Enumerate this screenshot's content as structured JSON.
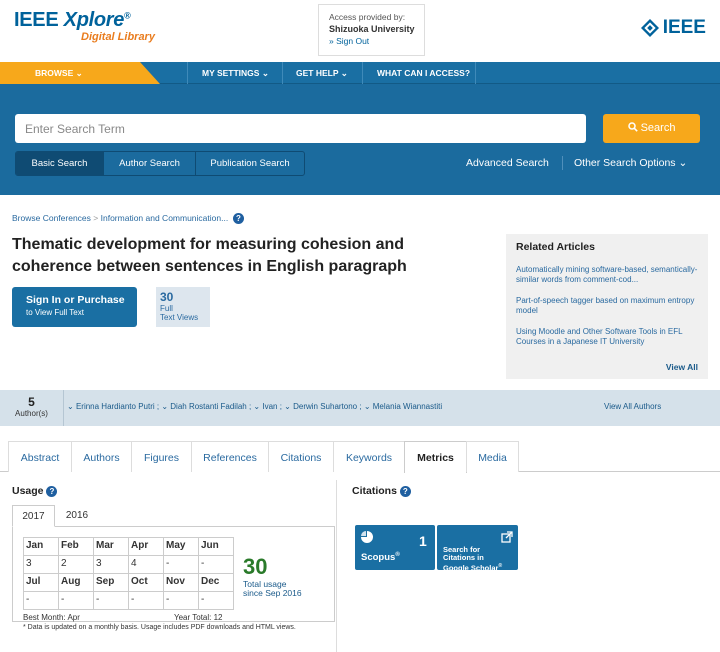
{
  "header": {
    "logo_main": "IEEE",
    "logo_xplore": "Xplore",
    "logo_reg": "®",
    "logo_sub": "Digital Library",
    "access_label": "Access provided by:",
    "access_institution": "Shizuoka University",
    "sign_out": "» Sign Out",
    "ieee_text": "IEEE"
  },
  "nav": {
    "browse": "BROWSE",
    "items": [
      "MY SETTINGS",
      "GET HELP",
      "WHAT CAN I ACCESS?"
    ]
  },
  "search": {
    "placeholder": "Enter Search Term",
    "button": "Search",
    "tabs": [
      "Basic Search",
      "Author Search",
      "Publication Search"
    ],
    "advanced": "Advanced Search",
    "other": "Other Search Options"
  },
  "breadcrumb": {
    "items": [
      "Browse Conferences",
      "Information and Communication..."
    ],
    "sep": ">"
  },
  "article": {
    "title": "Thematic development for measuring cohesion and coherence between sentences in English paragraph",
    "sign_in": "Sign In or Purchase",
    "sign_in_sub": "to View Full Text",
    "views_count": "30",
    "views_label1": "Full",
    "views_label2": "Text Views"
  },
  "related": {
    "title": "Related Articles",
    "items": [
      "Automatically mining software-based, semantically-similar words from comment-cod...",
      "Part-of-speech tagger based on maximum entropy model",
      "Using Moodle and Other Software Tools in EFL Courses in a Japanese IT University"
    ],
    "view_all": "View All"
  },
  "authors": {
    "count": "5",
    "count_label": "Author(s)",
    "list": [
      "Erinna Hardianto Putri",
      "Diah Rostanti Fadilah",
      "Ivan",
      "Derwin Suhartono",
      "Melania Wiannastiti"
    ],
    "view_all": "View All Authors"
  },
  "doc_tabs": [
    "Abstract",
    "Authors",
    "Figures",
    "References",
    "Citations",
    "Keywords",
    "Metrics",
    "Media"
  ],
  "active_tab": "Metrics",
  "usage": {
    "title": "Usage",
    "years": [
      "2017",
      "2016"
    ],
    "active_year": "2017",
    "months_row1": [
      "Jan",
      "Feb",
      "Mar",
      "Apr",
      "May",
      "Jun"
    ],
    "values_row1": [
      "3",
      "2",
      "3",
      "4",
      "-",
      "-"
    ],
    "months_row2": [
      "Jul",
      "Aug",
      "Sep",
      "Oct",
      "Nov",
      "Dec"
    ],
    "values_row2": [
      "-",
      "-",
      "-",
      "-",
      "-",
      "-"
    ],
    "total": "30",
    "total_label1": "Total usage",
    "total_label2": "since Sep 2016",
    "best_month": "Best Month: Apr",
    "year_total": "Year Total: 12",
    "note": "* Data is updated on a monthly basis. Usage includes PDF downloads and HTML views."
  },
  "citations": {
    "title": "Citations",
    "scopus_label": "Scopus",
    "scopus_reg": "®",
    "scopus_count": "1",
    "gs_line1": "Search for",
    "gs_line2": "Citations in",
    "gs_line3": "Google Scholar",
    "gs_reg": "®"
  },
  "colors": {
    "brand_blue": "#1a6fa3",
    "accent_orange": "#f7a81b",
    "link_blue": "#2a6aa0"
  }
}
